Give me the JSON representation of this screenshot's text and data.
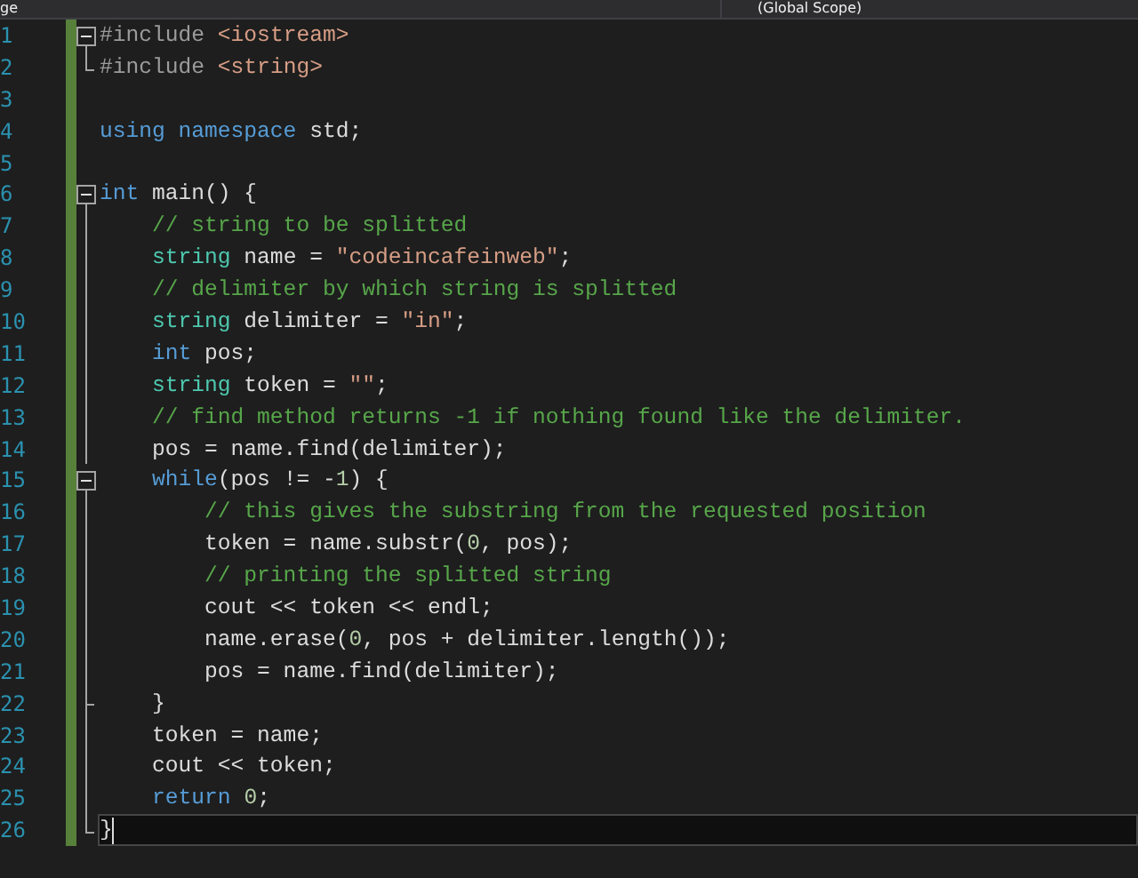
{
  "nav_bar": {
    "left_text": "ge",
    "scope": "(Global Scope)"
  },
  "lines": [
    {
      "number": "1",
      "kind": "start",
      "current": false,
      "tokens": [
        {
          "kind": "preproc",
          "text": "#include "
        },
        {
          "kind": "string",
          "text": "<iostream>"
        }
      ]
    },
    {
      "number": "2",
      "kind": "end",
      "current": false,
      "tokens": [
        {
          "kind": "preproc",
          "text": "#include "
        },
        {
          "kind": "string",
          "text": "<string>"
        }
      ]
    },
    {
      "number": "3",
      "kind": "plain",
      "current": false
    },
    {
      "number": "4",
      "kind": "plain",
      "current": false,
      "tokens": [
        {
          "kind": "keyword",
          "text": "using namespace "
        },
        {
          "kind": "plain",
          "text": "std;"
        }
      ]
    },
    {
      "number": "5",
      "kind": "plain",
      "current": false
    },
    {
      "number": "6",
      "kind": "start",
      "current": false,
      "tokens": [
        {
          "kind": "keyword",
          "text": "int"
        },
        {
          "kind": "plain",
          "text": " main() {"
        }
      ]
    },
    {
      "number": "7",
      "kind": "inside",
      "current": false,
      "tokens": [
        {
          "kind": "comment",
          "text": "    // string to be splitted"
        }
      ]
    },
    {
      "number": "8",
      "kind": "inside",
      "current": false,
      "tokens": [
        {
          "kind": "type",
          "text": "    string"
        },
        {
          "kind": "plain",
          "text": " name = "
        },
        {
          "kind": "string",
          "text": "\"codeincafeinweb\""
        },
        {
          "kind": "plain",
          "text": ";"
        }
      ]
    },
    {
      "number": "9",
      "kind": "inside",
      "current": false,
      "tokens": [
        {
          "kind": "comment",
          "text": "    // delimiter by which string is splitted"
        }
      ]
    },
    {
      "number": "10",
      "kind": "inside",
      "current": false,
      "tokens": [
        {
          "kind": "type",
          "text": "    string"
        },
        {
          "kind": "plain",
          "text": " delimiter = "
        },
        {
          "kind": "string",
          "text": "\"in\""
        },
        {
          "kind": "plain",
          "text": ";"
        }
      ]
    },
    {
      "number": "11",
      "kind": "inside",
      "current": false,
      "tokens": [
        {
          "kind": "keyword",
          "text": "    int"
        },
        {
          "kind": "plain",
          "text": " pos;"
        }
      ]
    },
    {
      "number": "12",
      "kind": "inside",
      "current": false,
      "tokens": [
        {
          "kind": "type",
          "text": "    string"
        },
        {
          "kind": "plain",
          "text": " token = "
        },
        {
          "kind": "string",
          "text": "\"\""
        },
        {
          "kind": "plain",
          "text": ";"
        }
      ]
    },
    {
      "number": "13",
      "kind": "inside",
      "current": false,
      "tokens": [
        {
          "kind": "comment",
          "text": "    // find method returns -1 if nothing found like the delimiter."
        }
      ]
    },
    {
      "number": "14",
      "kind": "inside",
      "current": false,
      "tokens": [
        {
          "kind": "plain",
          "text": "    pos = name.find(delimiter);"
        }
      ]
    },
    {
      "number": "15",
      "kind": "start",
      "current": false,
      "tokens": [
        {
          "kind": "keyword",
          "text": "    while"
        },
        {
          "kind": "plain",
          "text": "(pos != -"
        },
        {
          "kind": "number",
          "text": "1"
        },
        {
          "kind": "plain",
          "text": ") {"
        }
      ]
    },
    {
      "number": "16",
      "kind": "inside",
      "current": false,
      "tokens": [
        {
          "kind": "comment",
          "text": "        // this gives the substring from the requested position"
        }
      ]
    },
    {
      "number": "17",
      "kind": "inside",
      "current": false,
      "tokens": [
        {
          "kind": "plain",
          "text": "        token = name.substr("
        },
        {
          "kind": "number",
          "text": "0"
        },
        {
          "kind": "plain",
          "text": ", pos);"
        }
      ]
    },
    {
      "number": "18",
      "kind": "inside",
      "current": false,
      "tokens": [
        {
          "kind": "comment",
          "text": "        // printing the splitted string"
        }
      ]
    },
    {
      "number": "19",
      "kind": "inside",
      "current": false,
      "tokens": [
        {
          "kind": "plain",
          "text": "        cout << token << endl;"
        }
      ]
    },
    {
      "number": "20",
      "kind": "inside",
      "current": false,
      "tokens": [
        {
          "kind": "plain",
          "text": "        name.erase("
        },
        {
          "kind": "number",
          "text": "0"
        },
        {
          "kind": "plain",
          "text": ", pos + delimiter.length());"
        }
      ]
    },
    {
      "number": "21",
      "kind": "inside",
      "current": false,
      "tokens": [
        {
          "kind": "plain",
          "text": "        pos = name.find(delimiter);"
        }
      ]
    },
    {
      "number": "22",
      "kind": "close",
      "current": false,
      "tokens": [
        {
          "kind": "plain",
          "text": "    }"
        }
      ]
    },
    {
      "number": "23",
      "kind": "inside",
      "current": false,
      "tokens": [
        {
          "kind": "plain",
          "text": "    token = name;"
        }
      ]
    },
    {
      "number": "24",
      "kind": "inside",
      "current": false,
      "tokens": [
        {
          "kind": "plain",
          "text": "    cout << token;"
        }
      ]
    },
    {
      "number": "25",
      "kind": "inside",
      "current": false,
      "tokens": [
        {
          "kind": "keyword",
          "text": "    return "
        },
        {
          "kind": "number",
          "text": "0"
        },
        {
          "kind": "plain",
          "text": ";"
        }
      ]
    },
    {
      "number": "26",
      "kind": "end",
      "current": true,
      "tokens": [
        {
          "kind": "plain",
          "text": "}"
        }
      ]
    }
  ]
}
